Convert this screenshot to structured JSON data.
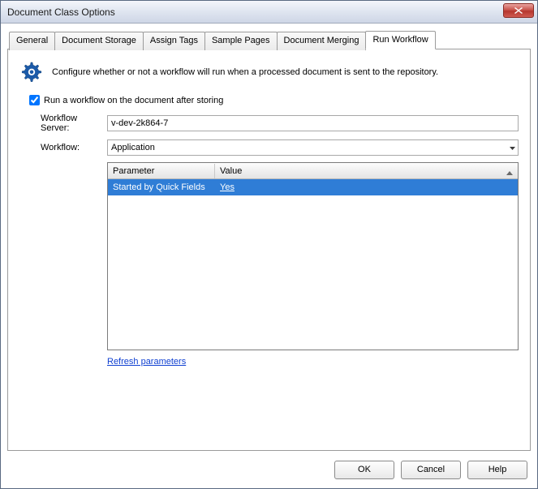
{
  "window": {
    "title": "Document Class Options"
  },
  "tabs": {
    "general": "General",
    "storage": "Document Storage",
    "tags": "Assign Tags",
    "samples": "Sample Pages",
    "merging": "Document Merging",
    "workflow": "Run Workflow"
  },
  "intro_text": "Configure whether or not a workflow will run when a processed document is sent to the repository.",
  "checkbox_label": "Run a workflow on the document after storing",
  "checkbox_checked": true,
  "labels": {
    "server": "Workflow Server:",
    "workflow": "Workflow:"
  },
  "server_value": "v-dev-2k864-7",
  "workflow_value": "Application",
  "grid": {
    "headers": {
      "parameter": "Parameter",
      "value": "Value"
    },
    "rows": [
      {
        "parameter": "Started by Quick Fields",
        "value": "Yes"
      }
    ]
  },
  "refresh_label": "Refresh parameters",
  "buttons": {
    "ok": "OK",
    "cancel": "Cancel",
    "help": "Help"
  },
  "icons": {
    "close": "close-icon",
    "gear": "gear-icon",
    "dropdown": "chevron-down-icon",
    "sort": "sort-asc-icon"
  }
}
